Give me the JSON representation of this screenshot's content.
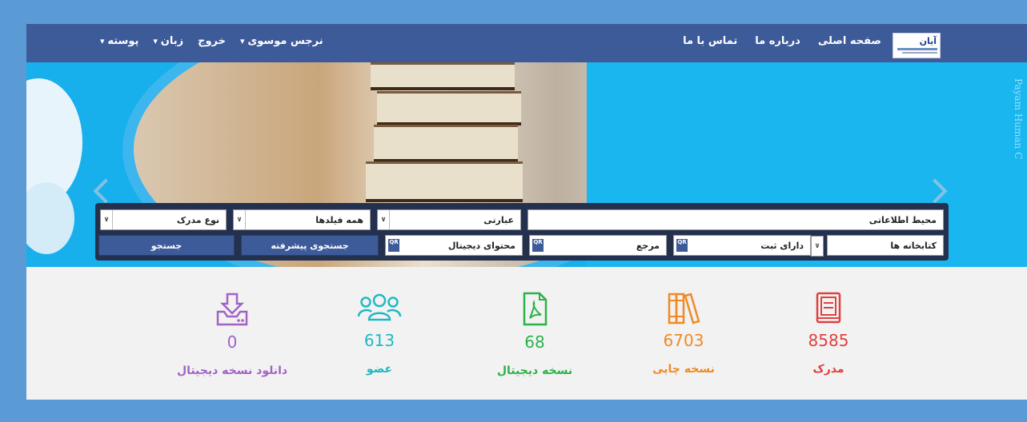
{
  "nav": {
    "logo_text": "آیان",
    "home": "صفحه اصلی",
    "about": "درباره ما",
    "contact": "تماس با ما",
    "user": "نرجس موسوی",
    "logout": "خروج",
    "language": "زبان",
    "mailbox": "پوسته"
  },
  "banner": {
    "watermark": "Payam Human C"
  },
  "search": {
    "info_scope": "محیط اطلاعاتی",
    "phrase": "عبارتی",
    "all_fields": "همه فیلدها",
    "doc_type": "نوع مدرک",
    "libraries": "کتابخانه ها",
    "has_registration": "دارای ثبت",
    "reference": "مرجع",
    "digital_content": "محتوای دیجیتال",
    "advanced_search": "جستجوی پیشرفته",
    "search_button": "جستجو",
    "qr_label": "QR"
  },
  "stats": [
    {
      "value": "8585",
      "label": "مدرک",
      "color": "#e0403e",
      "icon": "book-icon"
    },
    {
      "value": "6703",
      "label": "نسخه چاپی",
      "color": "#f08a24",
      "icon": "books-icon"
    },
    {
      "value": "68",
      "label": "نسخه دیجیتال",
      "color": "#2bb34a",
      "icon": "pdf-file-icon"
    },
    {
      "value": "613",
      "label": "عضو",
      "color": "#1fb9c4",
      "icon": "members-icon"
    },
    {
      "value": "0",
      "label": "دانلود نسخه دیجیتال",
      "color": "#a163c6",
      "icon": "download-icon"
    }
  ]
}
